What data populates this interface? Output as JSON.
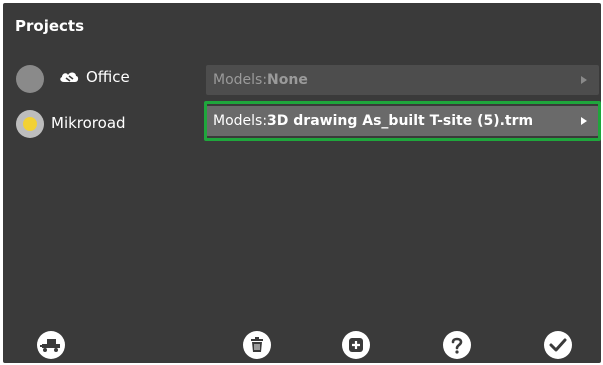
{
  "title": "Projects",
  "projects": [
    {
      "name": "Office",
      "selected": false,
      "icon": "cloud-icon",
      "models_prefix": "Models:",
      "models_value": "None",
      "enabled": false
    },
    {
      "name": "Mikroroad",
      "selected": true,
      "icon": null,
      "models_prefix": "Models:",
      "models_value": "3D drawing As_built T-site (5).trm",
      "enabled": true
    }
  ],
  "colors": {
    "background": "#3a3a3a",
    "selected_radio_dot": "#f2d134",
    "highlight_border": "#1fa63c"
  },
  "toolbar": {
    "buttons": [
      {
        "name": "machine-settings-button",
        "icon": "machine-icon"
      },
      {
        "name": "delete-button",
        "icon": "trash-icon"
      },
      {
        "name": "add-button",
        "icon": "plus-icon"
      },
      {
        "name": "help-button",
        "icon": "question-icon"
      },
      {
        "name": "confirm-button",
        "icon": "checkmark-icon"
      }
    ]
  }
}
